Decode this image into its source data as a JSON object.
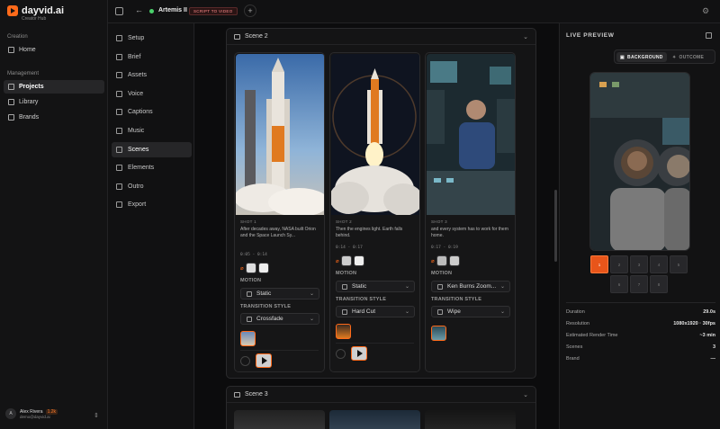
{
  "brand": {
    "name": "dayvid.ai",
    "subtitle": "Creator Hub"
  },
  "sidebar": {
    "sections": [
      {
        "title": "Creation",
        "items": [
          {
            "label": "Home",
            "icon": "home-icon",
            "active": false
          }
        ]
      },
      {
        "title": "Management",
        "items": [
          {
            "label": "Projects",
            "icon": "folder-icon",
            "active": true
          },
          {
            "label": "Library",
            "icon": "library-icon",
            "active": false
          },
          {
            "label": "Brands",
            "icon": "brand-icon",
            "active": false
          }
        ]
      }
    ],
    "user": {
      "initials": "A",
      "name": "Alex Rivera",
      "points": "1.2k",
      "email": "demo@dayvid.ai"
    }
  },
  "topbar": {
    "project_title": "Artemis II",
    "badge": "SCRIPT TO VIDEO",
    "add": "+"
  },
  "steps": [
    {
      "label": "Setup",
      "icon": "settings-icon"
    },
    {
      "label": "Brief",
      "icon": "doc-icon"
    },
    {
      "label": "Assets",
      "icon": "assets-icon"
    },
    {
      "label": "Voice",
      "icon": "mic-icon"
    },
    {
      "label": "Captions",
      "icon": "captions-icon"
    },
    {
      "label": "Music",
      "icon": "music-icon"
    },
    {
      "label": "Scenes",
      "icon": "scenes-icon",
      "active": true
    },
    {
      "label": "Elements",
      "icon": "elements-icon"
    },
    {
      "label": "Outro",
      "icon": "outro-icon"
    },
    {
      "label": "Export",
      "icon": "export-icon"
    }
  ],
  "scenes": [
    {
      "title": "Scene 2",
      "shots": [
        {
          "label": "SHOT 1",
          "text": "After decades away, NASA built Orion and the Space Launch Sy...",
          "time": "0:05 - 0:14",
          "motion": "Static",
          "transition": "Crossfade"
        },
        {
          "label": "SHOT 2",
          "text": "Then the engines light. Earth falls behind.",
          "time": "0:14 - 0:17",
          "motion": "Static",
          "transition": "Hard Cut"
        },
        {
          "label": "SHOT 3",
          "text": "and every system has to work for them home.",
          "time": "0:17 - 0:19",
          "motion": "Ken Burns Zoom...",
          "transition": "Wipe"
        }
      ]
    },
    {
      "title": "Scene 3"
    }
  ],
  "labels": {
    "motion": "MOTION",
    "transition": "TRANSITION STYLE"
  },
  "preview": {
    "title": "LIVE PREVIEW",
    "toggle": {
      "on": "BACKGROUND",
      "off": "OUTCOME"
    },
    "tiles": [
      "1",
      "2",
      "3",
      "4",
      "5",
      "6",
      "7",
      "8"
    ],
    "selected_tile": "1",
    "stats": [
      {
        "k": "Duration",
        "v": "29.0s"
      },
      {
        "k": "Resolution",
        "v": "1080x1920 · 30fps"
      },
      {
        "k": "Estimated Render Time",
        "v": "~3 min"
      },
      {
        "k": "Scenes",
        "v": "3"
      },
      {
        "k": "Brand",
        "v": "—"
      }
    ]
  },
  "colors": {
    "accent": "#ff6a1a",
    "bg": "#0e0e0f",
    "panel": "#141415"
  }
}
